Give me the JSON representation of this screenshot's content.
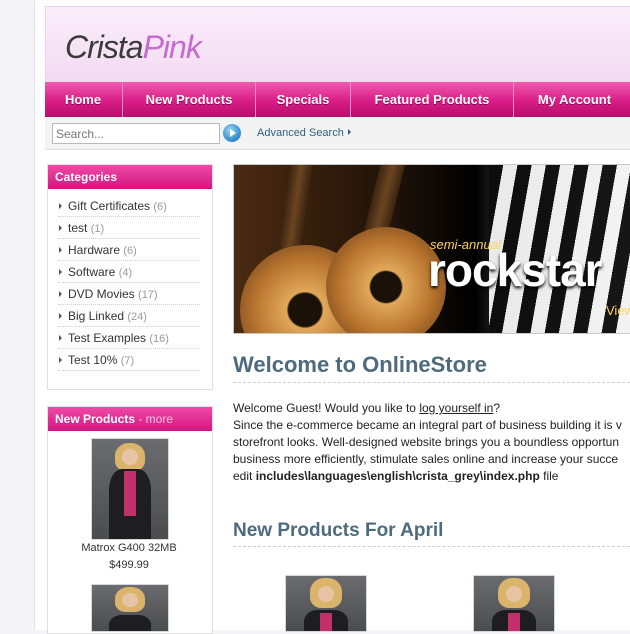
{
  "logo": {
    "part1": "Crista",
    "part2": "Pink"
  },
  "nav": [
    "Home",
    "New Products",
    "Specials",
    "Featured Products",
    "My Account"
  ],
  "search": {
    "placeholder": "Search...",
    "value": "Search...",
    "advanced_label": "Advanced Search"
  },
  "categories": {
    "title": "Categories",
    "items": [
      {
        "label": "Gift Certificates",
        "count": "(6)"
      },
      {
        "label": "test",
        "count": "(1)"
      },
      {
        "label": "Hardware",
        "count": "(6)"
      },
      {
        "label": "Software",
        "count": "(4)"
      },
      {
        "label": "DVD Movies",
        "count": "(17)"
      },
      {
        "label": "Big Linked",
        "count": "(24)"
      },
      {
        "label": "Test Examples",
        "count": "(16)"
      },
      {
        "label": "Test 10%",
        "count": "(7)"
      }
    ]
  },
  "new_products_box": {
    "title": "New Products",
    "more": " - more",
    "items": [
      {
        "name": "Matrox G400 32MB",
        "price": "$499.99"
      }
    ]
  },
  "banner": {
    "small_text": "semi-annual",
    "big_text": "rockstar",
    "link": "View"
  },
  "welcome": {
    "title": "Welcome to OnlineStore",
    "greeting_before": "Welcome Guest! Would you like to ",
    "login_link": "log yourself in",
    "greeting_after": "?",
    "line2": "Since the e-commerce became an integral part of business building it is v",
    "line3": "storefront looks. Well-designed website brings you a boundless opportun",
    "line4": "business more efficiently, stimulate sales online and increase your succe",
    "line5_prefix": "edit ",
    "line5_path": "includes\\languages\\english\\crista_grey\\index.php",
    "line5_suffix": " file"
  },
  "new_products_main": {
    "title": "New Products For April"
  },
  "colors": {
    "accent_pink": "#d81c87",
    "heading_blue": "#4d6b7d",
    "logo_purple": "#c56ad0"
  }
}
